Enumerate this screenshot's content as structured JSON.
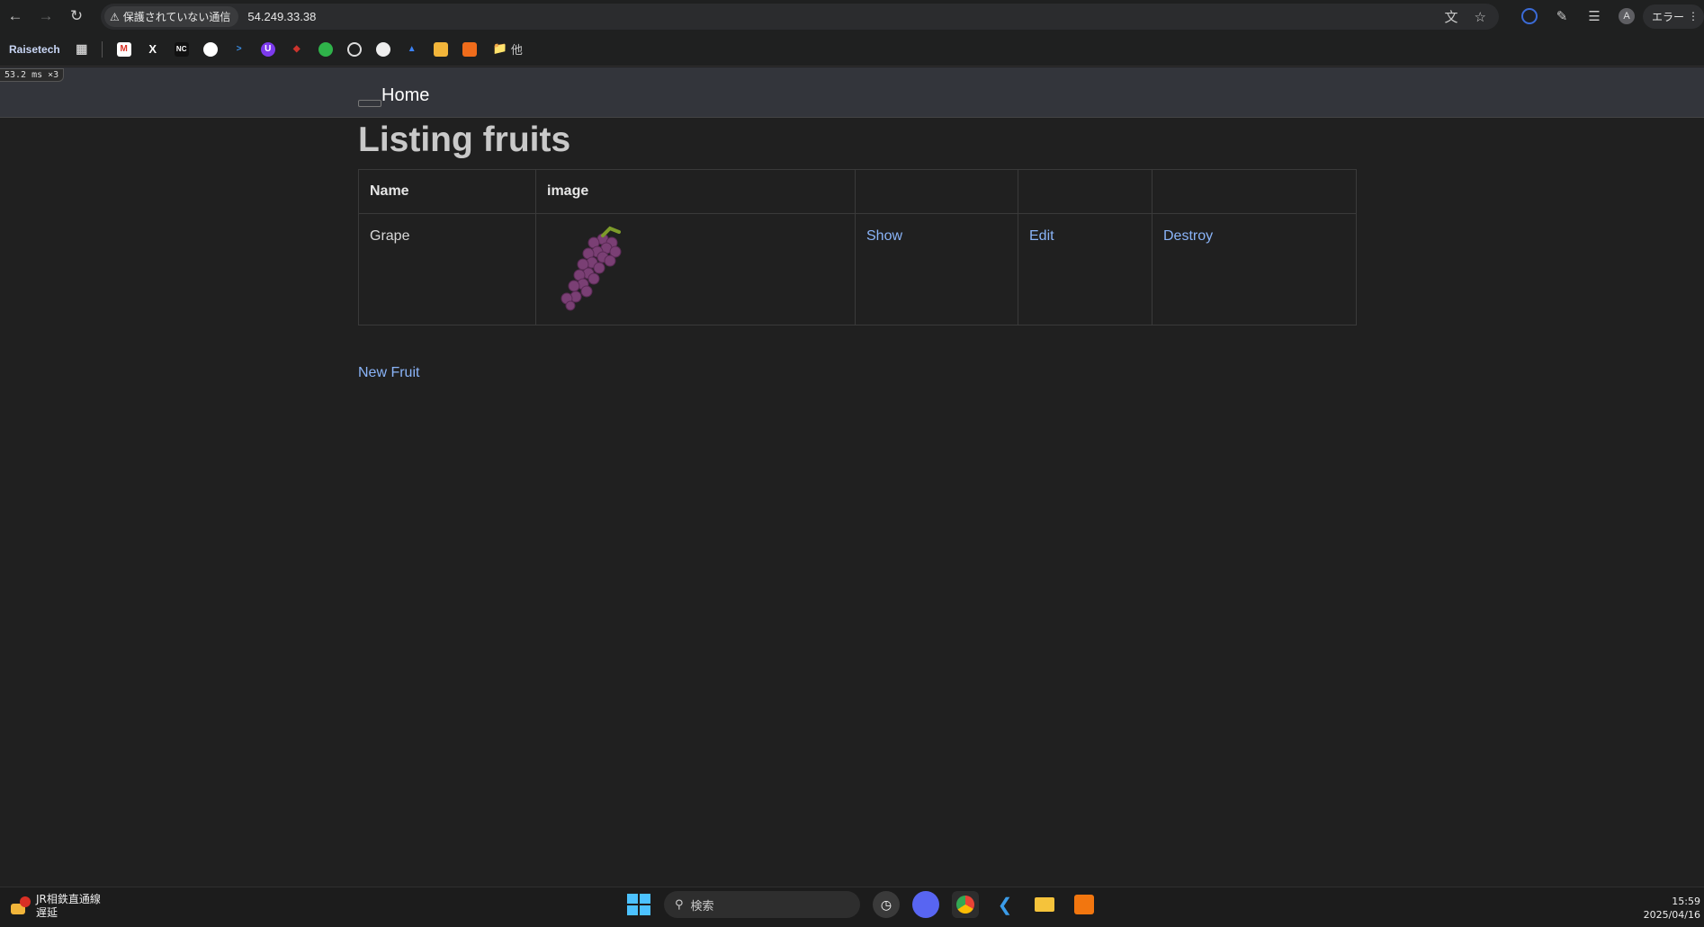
{
  "browser": {
    "security_label": "保護されていない通信",
    "url": "54.249.33.38",
    "error_label": "エラー"
  },
  "bookmarks": {
    "first_label": "Raisetech",
    "folder_label": "他",
    "icons": [
      "apps-icon",
      "gmail-icon",
      "x-icon",
      "nc-icon",
      "pacman-icon",
      "prompt-icon",
      "shield-icon",
      "ruby-icon",
      "green-app-icon",
      "openai-icon",
      "github-icon",
      "blue-app-icon",
      "notebook-icon",
      "cube-icon"
    ]
  },
  "dev": {
    "timing": "53.2 ms ×3"
  },
  "site": {
    "nav_home": "Home",
    "title": "Listing fruits",
    "table": {
      "headers": [
        "Name",
        "image",
        "",
        "",
        ""
      ],
      "rows": [
        {
          "name": "Grape",
          "show": "Show",
          "edit": "Edit",
          "destroy": "Destroy"
        }
      ]
    },
    "new_link": "New Fruit"
  },
  "taskbar": {
    "weather_title": "JR相鉄直通線",
    "weather_status": "遅延",
    "search_placeholder": "検索",
    "time": "15:59",
    "date": "2025/04/16"
  },
  "colors": {
    "link": "#8ab4f8",
    "background": "#202020",
    "header": "#33353b"
  }
}
